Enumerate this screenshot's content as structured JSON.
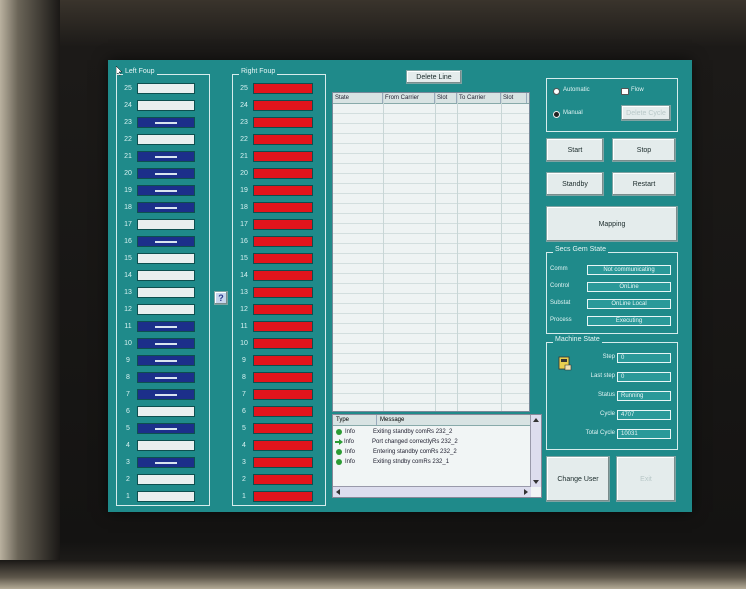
{
  "left_four": {
    "title": "Left Foup",
    "slots": [
      {
        "n": "25",
        "state": "white"
      },
      {
        "n": "24",
        "state": "white"
      },
      {
        "n": "23",
        "state": "blue"
      },
      {
        "n": "22",
        "state": "white"
      },
      {
        "n": "21",
        "state": "blue"
      },
      {
        "n": "20",
        "state": "blue"
      },
      {
        "n": "19",
        "state": "blue"
      },
      {
        "n": "18",
        "state": "blue"
      },
      {
        "n": "17",
        "state": "white"
      },
      {
        "n": "16",
        "state": "blue"
      },
      {
        "n": "15",
        "state": "white"
      },
      {
        "n": "14",
        "state": "white"
      },
      {
        "n": "13",
        "state": "white"
      },
      {
        "n": "12",
        "state": "white"
      },
      {
        "n": "11",
        "state": "blue"
      },
      {
        "n": "10",
        "state": "blue"
      },
      {
        "n": "9",
        "state": "blue"
      },
      {
        "n": "8",
        "state": "blue"
      },
      {
        "n": "7",
        "state": "blue"
      },
      {
        "n": "6",
        "state": "white"
      },
      {
        "n": "5",
        "state": "blue"
      },
      {
        "n": "4",
        "state": "white"
      },
      {
        "n": "3",
        "state": "blue"
      },
      {
        "n": "2",
        "state": "white"
      },
      {
        "n": "1",
        "state": "white"
      }
    ]
  },
  "right_four": {
    "title": "Right Foup",
    "slots": [
      "25",
      "24",
      "23",
      "22",
      "21",
      "20",
      "19",
      "18",
      "17",
      "16",
      "15",
      "14",
      "13",
      "12",
      "11",
      "10",
      "9",
      "8",
      "7",
      "6",
      "5",
      "4",
      "3",
      "2",
      "1"
    ]
  },
  "help_button": "?",
  "center": {
    "delete_line": "Delete Line",
    "columns": [
      "State",
      "From Carrier",
      "Slot",
      "To Carrier",
      "Slot"
    ]
  },
  "log": {
    "columns": [
      "Type",
      "Message"
    ],
    "rows": [
      {
        "icon": "green-dot",
        "type": "Info",
        "message": "Exiting standby comRs 232_2"
      },
      {
        "icon": "green-arrow",
        "type": "Info",
        "message": "Port changed correctlyRs 232_2"
      },
      {
        "icon": "green-dot",
        "type": "Info",
        "message": "Entering standby comRs 232_2"
      },
      {
        "icon": "green-dot",
        "type": "Info",
        "message": "Exiting stndby comRs 232_1"
      }
    ]
  },
  "mode": {
    "automatic": "Automatic",
    "flow": "Flow",
    "manual": "Manual",
    "delete_cycle": "Delete Cycle"
  },
  "buttons": {
    "start": "Start",
    "stop": "Stop",
    "standby": "Standby",
    "restart": "Restart",
    "mapping": "Mapping",
    "change_user": "Change User",
    "exit": "Exit"
  },
  "secs_gem": {
    "title": "Secs Gem State",
    "rows": [
      {
        "label": "Comm",
        "value": "Not communicating"
      },
      {
        "label": "Control",
        "value": "OnLine"
      },
      {
        "label": "Substat",
        "value": "OnLine Local"
      },
      {
        "label": "Process",
        "value": "Executing"
      }
    ]
  },
  "machine": {
    "title": "Machine State",
    "rows": [
      {
        "label": "Step",
        "value": "0"
      },
      {
        "label": "Last step",
        "value": "0"
      },
      {
        "label": "Status",
        "value": "Running"
      },
      {
        "label": "Cycle",
        "value": "4707"
      },
      {
        "label": "Total Cycle",
        "value": "10031"
      }
    ]
  },
  "colors": {
    "screen": "#1f8a8a",
    "slot_blue": "#1c2f8a",
    "slot_red": "#e2141c",
    "slot_white": "#e9efef"
  }
}
